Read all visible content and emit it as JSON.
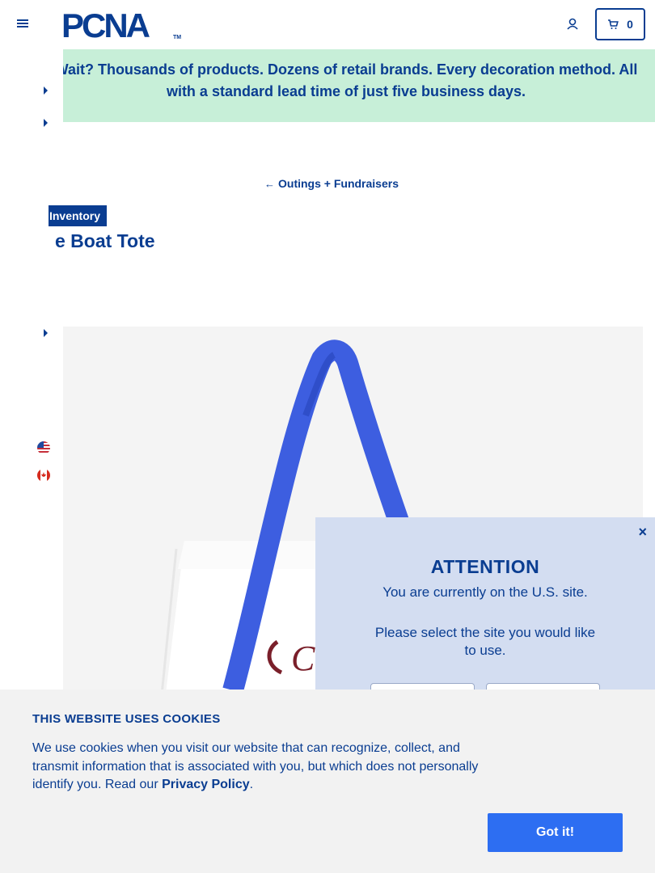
{
  "header": {
    "logo_text": "PCNA",
    "logo_trademark": "TM",
    "cart_count": "0"
  },
  "banner": {
    "text": "Wait? Thousands of products. Dozens of retail brands. Every decoration method. All with a standard lead time of just five business days."
  },
  "breadcrumb": {
    "arrow": "←",
    "label": "Outings + Fundraisers"
  },
  "product": {
    "badge": "Inventory",
    "title": "e Boat Tote"
  },
  "attention": {
    "close": "×",
    "title": "ATTENTION",
    "message": "You are currently on the U.S. site.",
    "prompt": "Please select the site you would like to use."
  },
  "cookie": {
    "title": "THIS WEBSITE USES COOKIES",
    "text_before": "We use cookies when you visit our website that can recognize, collect, and transmit information that is associated with you, but which does not personally identify you. Read our ",
    "link": "Privacy Policy",
    "text_after": ".",
    "button": "Got it!"
  },
  "colors": {
    "brand_navy": "#0a3d91",
    "banner_green": "#c7efd8",
    "modal_blue": "#d3ddf1",
    "button_blue": "#2d6ef2",
    "strap_blue": "#3d5ee0"
  }
}
